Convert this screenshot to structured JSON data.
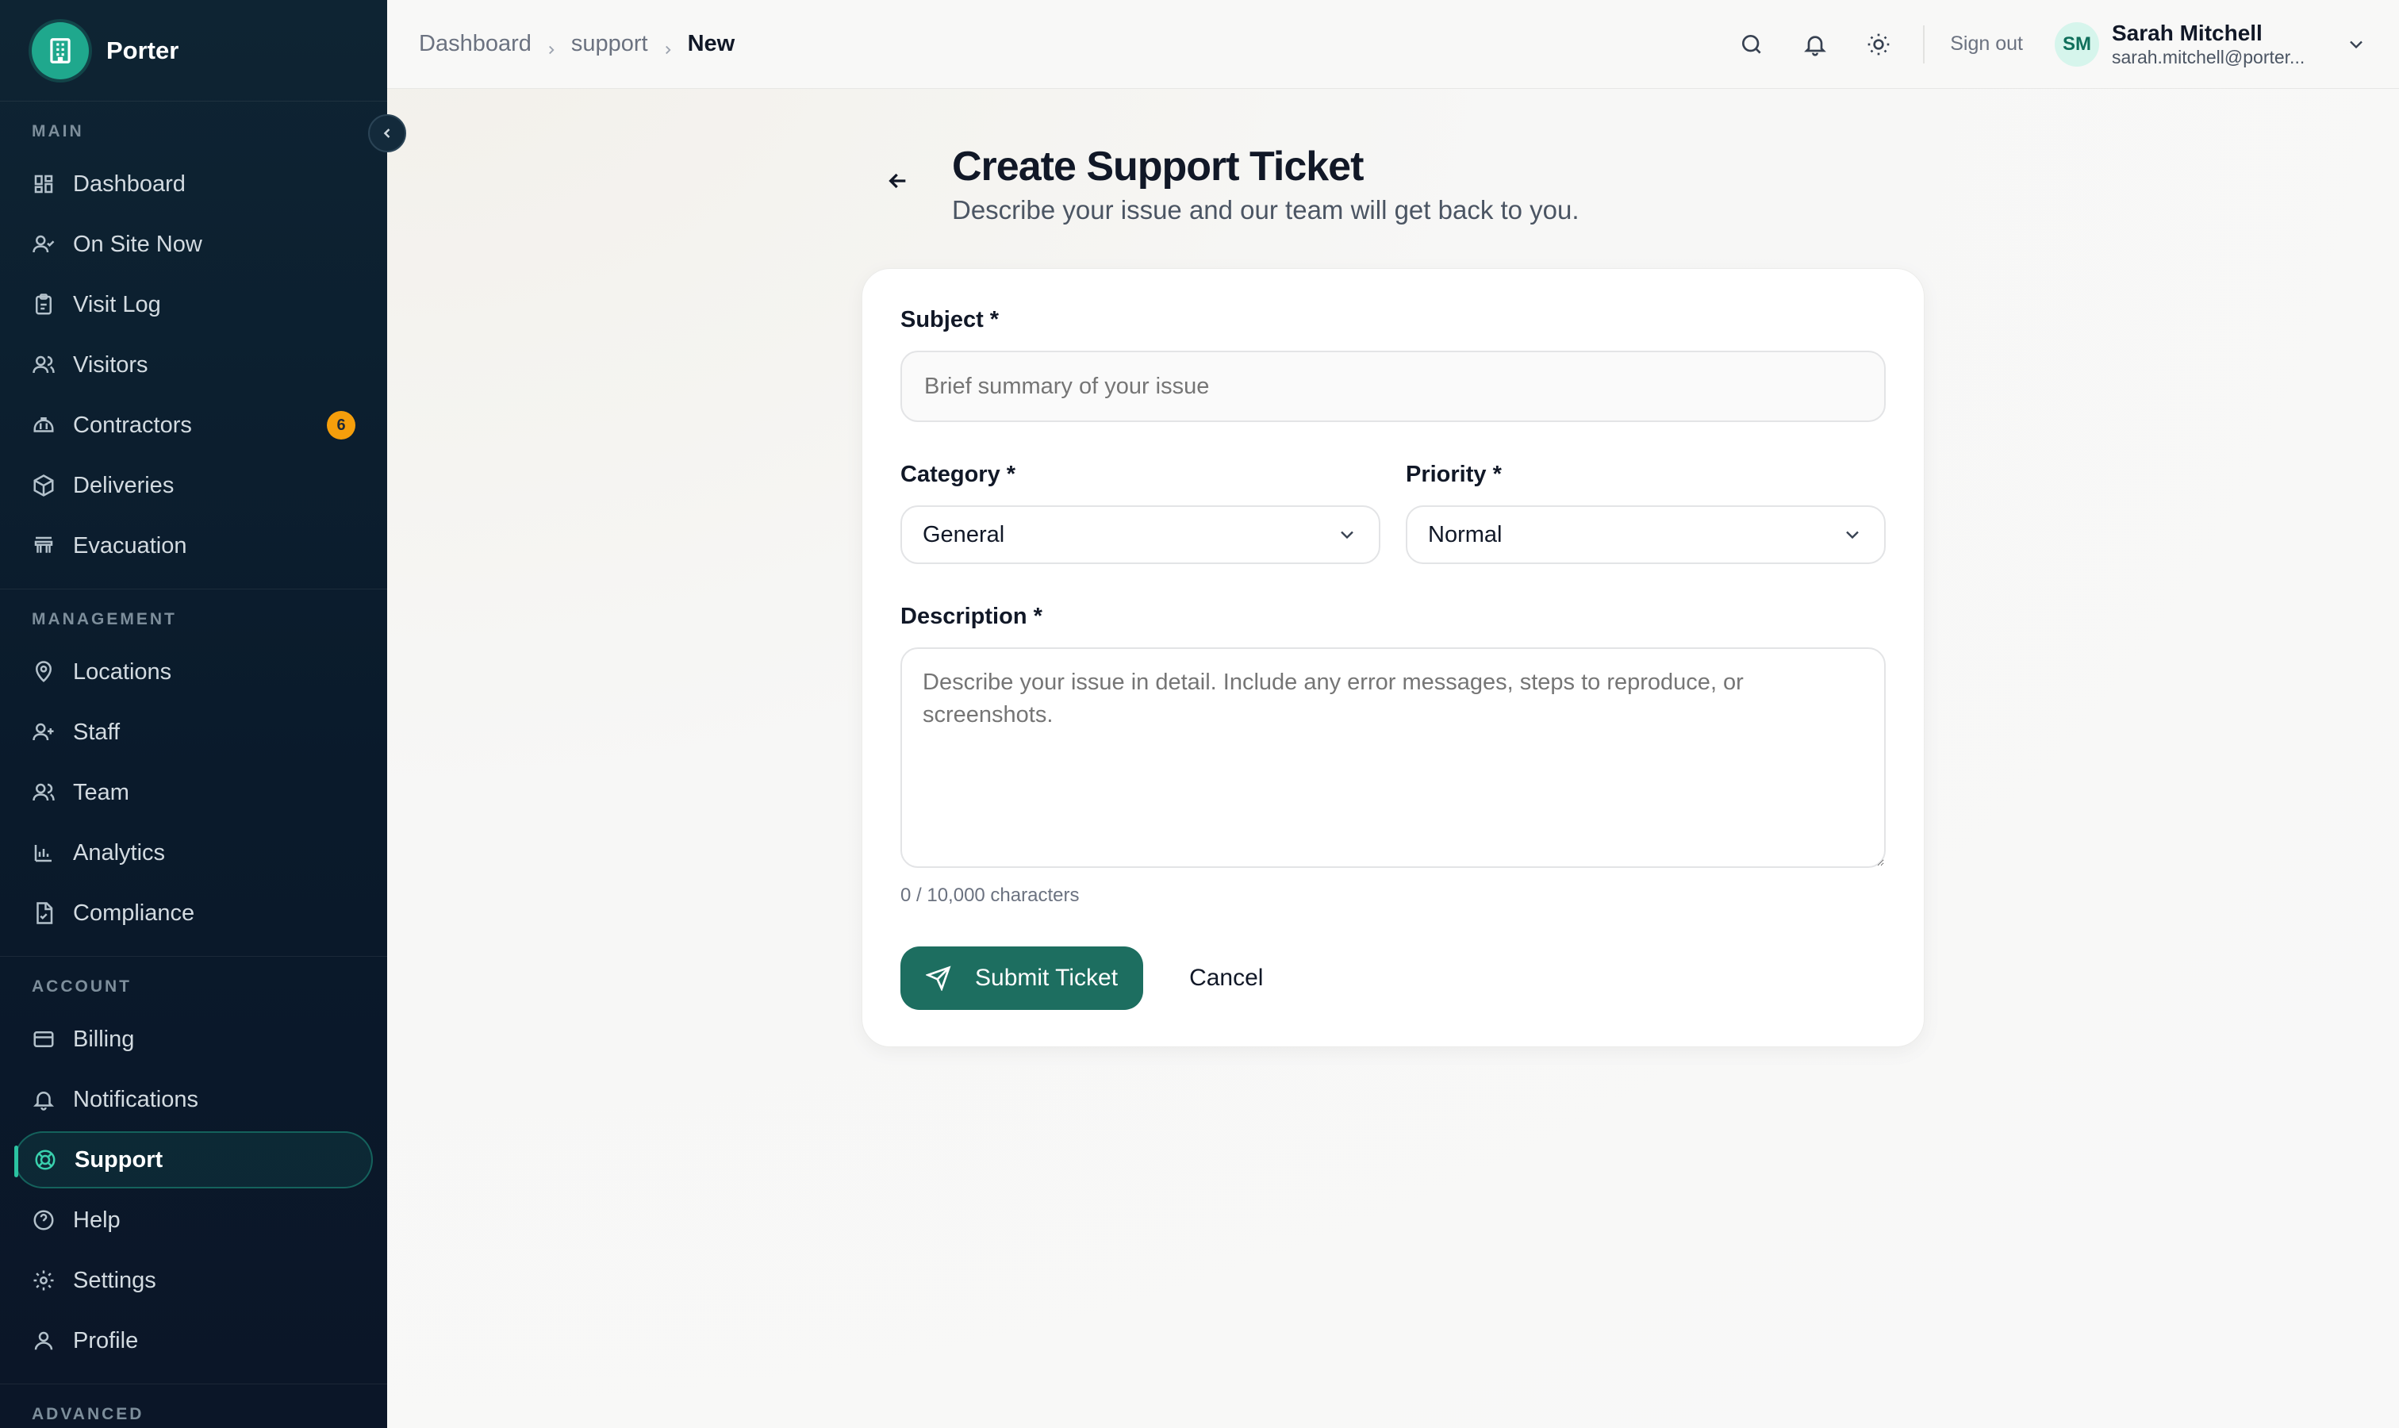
{
  "brand": {
    "name": "Porter"
  },
  "sidebar": {
    "sections": [
      {
        "title": "MAIN",
        "items": [
          {
            "label": "Dashboard",
            "icon": "dashboard-icon"
          },
          {
            "label": "On Site Now",
            "icon": "user-check-icon"
          },
          {
            "label": "Visit Log",
            "icon": "clipboard-icon"
          },
          {
            "label": "Visitors",
            "icon": "users-icon"
          },
          {
            "label": "Contractors",
            "icon": "hard-hat-icon",
            "badge": "6"
          },
          {
            "label": "Deliveries",
            "icon": "package-icon"
          },
          {
            "label": "Evacuation",
            "icon": "alarm-icon"
          }
        ]
      },
      {
        "title": "MANAGEMENT",
        "items": [
          {
            "label": "Locations",
            "icon": "map-pin-icon"
          },
          {
            "label": "Staff",
            "icon": "user-plus-icon"
          },
          {
            "label": "Team",
            "icon": "users-icon"
          },
          {
            "label": "Analytics",
            "icon": "bar-chart-icon"
          },
          {
            "label": "Compliance",
            "icon": "file-check-icon"
          }
        ]
      },
      {
        "title": "ACCOUNT",
        "items": [
          {
            "label": "Billing",
            "icon": "credit-card-icon"
          },
          {
            "label": "Notifications",
            "icon": "bell-icon"
          },
          {
            "label": "Support",
            "icon": "lifebuoy-icon",
            "active": true
          },
          {
            "label": "Help",
            "icon": "help-circle-icon"
          },
          {
            "label": "Settings",
            "icon": "gear-icon"
          },
          {
            "label": "Profile",
            "icon": "user-icon"
          }
        ]
      },
      {
        "title": "ADVANCED",
        "items": []
      }
    ]
  },
  "breadcrumb": {
    "items": [
      "Dashboard",
      "support"
    ],
    "current": "New"
  },
  "topbar": {
    "signout": "Sign out",
    "user": {
      "initials": "SM",
      "name": "Sarah Mitchell",
      "email": "sarah.mitchell@porter..."
    }
  },
  "page": {
    "title": "Create Support Ticket",
    "subtitle": "Describe your issue and our team will get back to you."
  },
  "form": {
    "subject": {
      "label": "Subject *",
      "placeholder": "Brief summary of your issue",
      "value": ""
    },
    "category": {
      "label": "Category *",
      "value": "General"
    },
    "priority": {
      "label": "Priority *",
      "value": "Normal"
    },
    "description": {
      "label": "Description *",
      "placeholder": "Describe your issue in detail. Include any error messages, steps to reproduce, or screenshots.",
      "count": "0 / 10,000 characters"
    },
    "submit_label": "Submit Ticket",
    "cancel_label": "Cancel"
  },
  "colors": {
    "accent": "#1d6e60",
    "sidebar_bg": "#0e2433",
    "badge": "#f59e0b"
  }
}
